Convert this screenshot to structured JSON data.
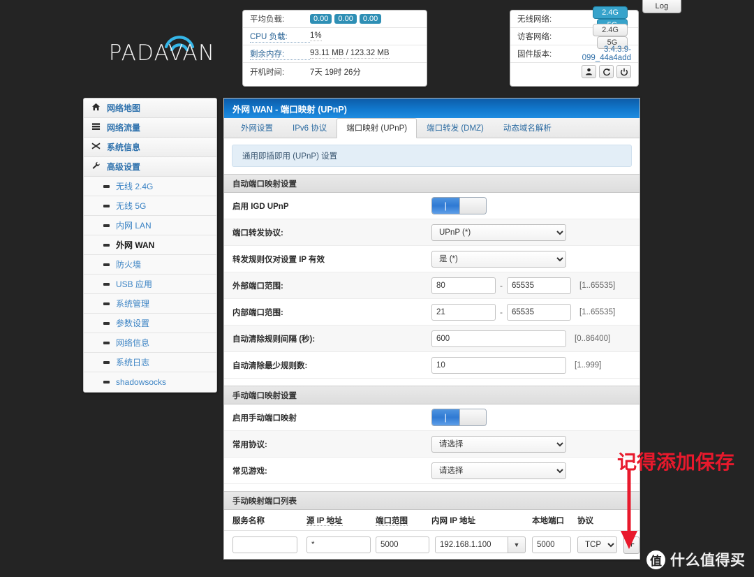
{
  "log_tab": {
    "label": "Log"
  },
  "brand": {
    "name": "PADAVAN",
    "wifi_icon": "wifi-icon"
  },
  "status_left": {
    "rows": [
      {
        "label": "平均负载:",
        "type": "badges",
        "values": [
          "0.00",
          "0.00",
          "0.00"
        ]
      },
      {
        "label": "CPU 负载:",
        "type": "text",
        "value": "1%",
        "label_link": true
      },
      {
        "label": "剩余内存:",
        "type": "text",
        "value": "93.11 MB / 123.32 MB",
        "label_link": true
      },
      {
        "label": "开机时间:",
        "type": "plain",
        "value": "7天 19时 26分"
      }
    ]
  },
  "status_right": {
    "wireless_label": "无线网络:",
    "wireless_buttons": [
      {
        "label": "2.4G",
        "on": true
      },
      {
        "label": "5G",
        "on": true
      }
    ],
    "guest_label": "访客网络:",
    "guest_buttons": [
      {
        "label": "2.4G",
        "on": false
      },
      {
        "label": "5G",
        "on": false
      }
    ],
    "firmware_label": "固件版本:",
    "firmware_value": "3.4.3.9-099_44a4add",
    "action_icons": [
      {
        "name": "user-icon",
        "glyph": "♟"
      },
      {
        "name": "refresh-icon",
        "glyph": "↻"
      },
      {
        "name": "power-icon",
        "glyph": "⏻"
      }
    ]
  },
  "sidebar": {
    "top_items": [
      {
        "label": "网络地图",
        "icon": "home-icon",
        "glyph": "⌂"
      },
      {
        "label": "网络流量",
        "icon": "traffic-icon",
        "glyph": "☰"
      },
      {
        "label": "系统信息",
        "icon": "shuffle-icon",
        "glyph": "⤨"
      },
      {
        "label": "高级设置",
        "icon": "wrench-icon",
        "glyph": "⚒"
      }
    ],
    "sub_items": [
      {
        "label": "无线 2.4G",
        "active": false
      },
      {
        "label": "无线 5G",
        "active": false
      },
      {
        "label": "内网 LAN",
        "active": false
      },
      {
        "label": "外网 WAN",
        "active": true
      },
      {
        "label": "防火墙",
        "active": false
      },
      {
        "label": "USB 应用",
        "active": false
      },
      {
        "label": "系统管理",
        "active": false
      },
      {
        "label": "参数设置",
        "active": false
      },
      {
        "label": "网络信息",
        "active": false
      },
      {
        "label": "系统日志",
        "active": false
      },
      {
        "label": "shadowsocks",
        "active": false
      }
    ]
  },
  "main": {
    "title": "外网 WAN - 端口映射 (UPnP)",
    "tabs": [
      {
        "label": "外网设置",
        "active": false
      },
      {
        "label": "IPv6 协议",
        "active": false
      },
      {
        "label": "端口映射 (UPnP)",
        "active": true
      },
      {
        "label": "端口转发 (DMZ)",
        "active": false
      },
      {
        "label": "动态域名解析",
        "active": false
      }
    ],
    "subhead": "通用即插即用 (UPnP) 设置",
    "auto_section": {
      "heading": "自动端口映射设置",
      "igd_label": "启用 IGD UPnP",
      "igd_enabled": true,
      "protocol_label": "端口转发协议:",
      "protocol_value": "UPnP (*)",
      "restrict_label": "转发规则仅对设置 IP 有效",
      "restrict_value": "是 (*)",
      "ext_port_label": "外部端口范围:",
      "ext_port_from": "80",
      "ext_port_to": "65535",
      "ext_port_hint": "[1..65535]",
      "int_port_label": "内部端口范围:",
      "int_port_from": "21",
      "int_port_to": "65535",
      "int_port_hint": "[1..65535]",
      "clean_interval_label": "自动清除规则间隔 (秒):",
      "clean_interval_value": "600",
      "clean_interval_hint": "[0..86400]",
      "min_rules_label": "自动清除最少规则数:",
      "min_rules_value": "10",
      "min_rules_hint": "[1..999]"
    },
    "manual_section": {
      "heading": "手动端口映射设置",
      "enable_label": "启用手动端口映射",
      "enable_enabled": true,
      "common_protocol_label": "常用协议:",
      "common_protocol_value": "请选择",
      "common_game_label": "常见游戏:",
      "common_game_value": "请选择"
    },
    "table": {
      "heading": "手动映射端口列表",
      "columns": [
        {
          "label": "服务名称",
          "dotted": false
        },
        {
          "label": "源 IP 地址",
          "dotted": true
        },
        {
          "label": "端口范围",
          "dotted": true
        },
        {
          "label": "内网 IP 地址",
          "dotted": false
        },
        {
          "label": "本地端口",
          "dotted": false
        },
        {
          "label": "协议",
          "dotted": false
        }
      ],
      "row": {
        "service_name": "",
        "service_name_placeholder": "",
        "source_ip": "*",
        "port_range": "5000",
        "lan_ip": "192.168.1.100",
        "local_port": "5000",
        "protocol": "TCP",
        "add_button": "+"
      }
    }
  },
  "annotation": {
    "text": "记得添加保存",
    "color": "#e8192c",
    "arrow": "down-arrow-icon"
  },
  "watermark": {
    "logo_char": "值",
    "text": "什么值得买"
  }
}
